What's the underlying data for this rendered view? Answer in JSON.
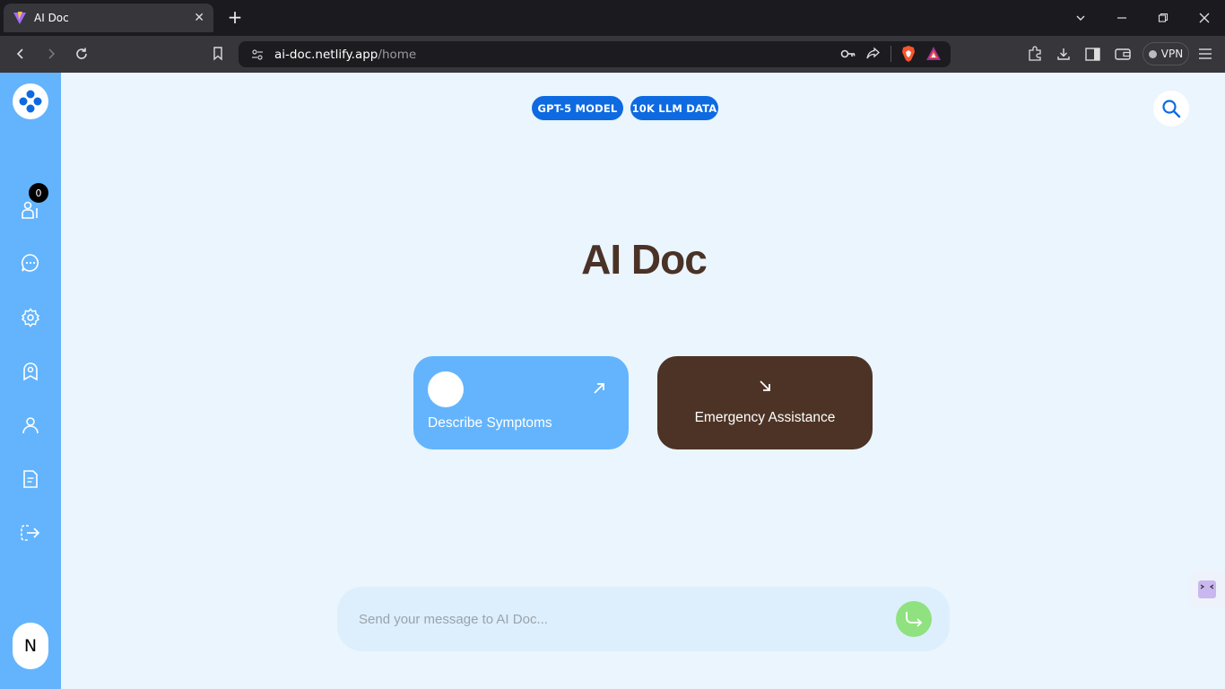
{
  "browser": {
    "tab_title": "AI Doc",
    "tab_close": "✕",
    "new_tab": "+",
    "url_host": "ai-doc.netlify.app",
    "url_path": "/home",
    "vpn_label": "VPN"
  },
  "sidebar": {
    "badge_count": "0",
    "items": [
      {
        "icon": "doctor-icon"
      },
      {
        "icon": "chat-icon"
      },
      {
        "icon": "settings-icon"
      },
      {
        "icon": "ambulance-icon"
      },
      {
        "icon": "user-icon"
      },
      {
        "icon": "document-icon"
      },
      {
        "icon": "logout-icon"
      }
    ],
    "avatar_initial": "N"
  },
  "header": {
    "pills": [
      "GPT-5 MODEL",
      "10K LLM DATA"
    ]
  },
  "main": {
    "title": "AI Doc",
    "cards": {
      "describe": "Describe Symptoms",
      "emergency": "Emergency Assistance"
    }
  },
  "composer": {
    "placeholder": "Send your message to AI Doc...",
    "value": ""
  },
  "colors": {
    "sidebar": "#63b4fd",
    "pill": "#0d6ae0",
    "title": "#4a3227",
    "emergency_card": "#4d3326",
    "send_button": "#8fe27f",
    "background": "#eaf5fe"
  }
}
